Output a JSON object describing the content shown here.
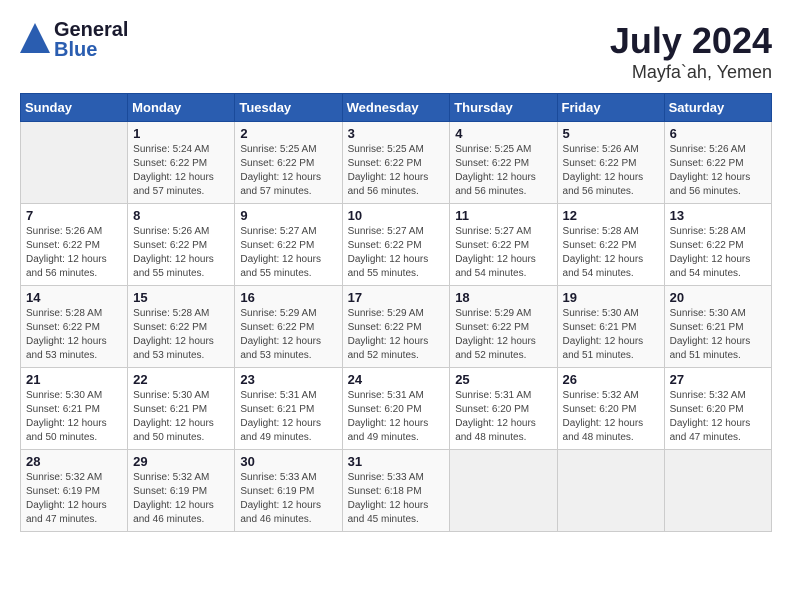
{
  "header": {
    "logo_general": "General",
    "logo_blue": "Blue",
    "month": "July 2024",
    "location": "Mayfa`ah, Yemen"
  },
  "weekdays": [
    "Sunday",
    "Monday",
    "Tuesday",
    "Wednesday",
    "Thursday",
    "Friday",
    "Saturday"
  ],
  "weeks": [
    [
      {
        "day": "",
        "sunrise": "",
        "sunset": "",
        "daylight": ""
      },
      {
        "day": "1",
        "sunrise": "Sunrise: 5:24 AM",
        "sunset": "Sunset: 6:22 PM",
        "daylight": "Daylight: 12 hours and 57 minutes."
      },
      {
        "day": "2",
        "sunrise": "Sunrise: 5:25 AM",
        "sunset": "Sunset: 6:22 PM",
        "daylight": "Daylight: 12 hours and 57 minutes."
      },
      {
        "day": "3",
        "sunrise": "Sunrise: 5:25 AM",
        "sunset": "Sunset: 6:22 PM",
        "daylight": "Daylight: 12 hours and 56 minutes."
      },
      {
        "day": "4",
        "sunrise": "Sunrise: 5:25 AM",
        "sunset": "Sunset: 6:22 PM",
        "daylight": "Daylight: 12 hours and 56 minutes."
      },
      {
        "day": "5",
        "sunrise": "Sunrise: 5:26 AM",
        "sunset": "Sunset: 6:22 PM",
        "daylight": "Daylight: 12 hours and 56 minutes."
      },
      {
        "day": "6",
        "sunrise": "Sunrise: 5:26 AM",
        "sunset": "Sunset: 6:22 PM",
        "daylight": "Daylight: 12 hours and 56 minutes."
      }
    ],
    [
      {
        "day": "7",
        "sunrise": "Sunrise: 5:26 AM",
        "sunset": "Sunset: 6:22 PM",
        "daylight": "Daylight: 12 hours and 56 minutes."
      },
      {
        "day": "8",
        "sunrise": "Sunrise: 5:26 AM",
        "sunset": "Sunset: 6:22 PM",
        "daylight": "Daylight: 12 hours and 55 minutes."
      },
      {
        "day": "9",
        "sunrise": "Sunrise: 5:27 AM",
        "sunset": "Sunset: 6:22 PM",
        "daylight": "Daylight: 12 hours and 55 minutes."
      },
      {
        "day": "10",
        "sunrise": "Sunrise: 5:27 AM",
        "sunset": "Sunset: 6:22 PM",
        "daylight": "Daylight: 12 hours and 55 minutes."
      },
      {
        "day": "11",
        "sunrise": "Sunrise: 5:27 AM",
        "sunset": "Sunset: 6:22 PM",
        "daylight": "Daylight: 12 hours and 54 minutes."
      },
      {
        "day": "12",
        "sunrise": "Sunrise: 5:28 AM",
        "sunset": "Sunset: 6:22 PM",
        "daylight": "Daylight: 12 hours and 54 minutes."
      },
      {
        "day": "13",
        "sunrise": "Sunrise: 5:28 AM",
        "sunset": "Sunset: 6:22 PM",
        "daylight": "Daylight: 12 hours and 54 minutes."
      }
    ],
    [
      {
        "day": "14",
        "sunrise": "Sunrise: 5:28 AM",
        "sunset": "Sunset: 6:22 PM",
        "daylight": "Daylight: 12 hours and 53 minutes."
      },
      {
        "day": "15",
        "sunrise": "Sunrise: 5:28 AM",
        "sunset": "Sunset: 6:22 PM",
        "daylight": "Daylight: 12 hours and 53 minutes."
      },
      {
        "day": "16",
        "sunrise": "Sunrise: 5:29 AM",
        "sunset": "Sunset: 6:22 PM",
        "daylight": "Daylight: 12 hours and 53 minutes."
      },
      {
        "day": "17",
        "sunrise": "Sunrise: 5:29 AM",
        "sunset": "Sunset: 6:22 PM",
        "daylight": "Daylight: 12 hours and 52 minutes."
      },
      {
        "day": "18",
        "sunrise": "Sunrise: 5:29 AM",
        "sunset": "Sunset: 6:22 PM",
        "daylight": "Daylight: 12 hours and 52 minutes."
      },
      {
        "day": "19",
        "sunrise": "Sunrise: 5:30 AM",
        "sunset": "Sunset: 6:21 PM",
        "daylight": "Daylight: 12 hours and 51 minutes."
      },
      {
        "day": "20",
        "sunrise": "Sunrise: 5:30 AM",
        "sunset": "Sunset: 6:21 PM",
        "daylight": "Daylight: 12 hours and 51 minutes."
      }
    ],
    [
      {
        "day": "21",
        "sunrise": "Sunrise: 5:30 AM",
        "sunset": "Sunset: 6:21 PM",
        "daylight": "Daylight: 12 hours and 50 minutes."
      },
      {
        "day": "22",
        "sunrise": "Sunrise: 5:30 AM",
        "sunset": "Sunset: 6:21 PM",
        "daylight": "Daylight: 12 hours and 50 minutes."
      },
      {
        "day": "23",
        "sunrise": "Sunrise: 5:31 AM",
        "sunset": "Sunset: 6:21 PM",
        "daylight": "Daylight: 12 hours and 49 minutes."
      },
      {
        "day": "24",
        "sunrise": "Sunrise: 5:31 AM",
        "sunset": "Sunset: 6:20 PM",
        "daylight": "Daylight: 12 hours and 49 minutes."
      },
      {
        "day": "25",
        "sunrise": "Sunrise: 5:31 AM",
        "sunset": "Sunset: 6:20 PM",
        "daylight": "Daylight: 12 hours and 48 minutes."
      },
      {
        "day": "26",
        "sunrise": "Sunrise: 5:32 AM",
        "sunset": "Sunset: 6:20 PM",
        "daylight": "Daylight: 12 hours and 48 minutes."
      },
      {
        "day": "27",
        "sunrise": "Sunrise: 5:32 AM",
        "sunset": "Sunset: 6:20 PM",
        "daylight": "Daylight: 12 hours and 47 minutes."
      }
    ],
    [
      {
        "day": "28",
        "sunrise": "Sunrise: 5:32 AM",
        "sunset": "Sunset: 6:19 PM",
        "daylight": "Daylight: 12 hours and 47 minutes."
      },
      {
        "day": "29",
        "sunrise": "Sunrise: 5:32 AM",
        "sunset": "Sunset: 6:19 PM",
        "daylight": "Daylight: 12 hours and 46 minutes."
      },
      {
        "day": "30",
        "sunrise": "Sunrise: 5:33 AM",
        "sunset": "Sunset: 6:19 PM",
        "daylight": "Daylight: 12 hours and 46 minutes."
      },
      {
        "day": "31",
        "sunrise": "Sunrise: 5:33 AM",
        "sunset": "Sunset: 6:18 PM",
        "daylight": "Daylight: 12 hours and 45 minutes."
      },
      {
        "day": "",
        "sunrise": "",
        "sunset": "",
        "daylight": ""
      },
      {
        "day": "",
        "sunrise": "",
        "sunset": "",
        "daylight": ""
      },
      {
        "day": "",
        "sunrise": "",
        "sunset": "",
        "daylight": ""
      }
    ]
  ]
}
